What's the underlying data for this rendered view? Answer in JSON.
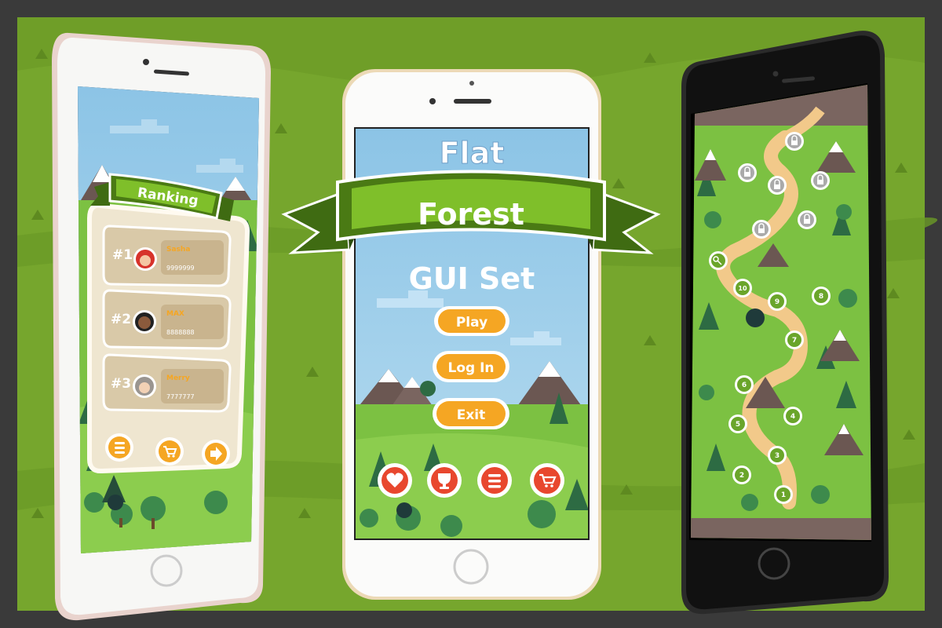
{
  "colors": {
    "frame": "#3a3a3a",
    "banner_green": "#4a7a14",
    "banner_light": "#7fbf2a",
    "button_orange": "#f5a623",
    "icon_red": "#e8472e",
    "sky": "#9bcbe8",
    "grass": "#7cc142",
    "panel_beige": "#d9c9a8",
    "path_sand": "#f2c98a"
  },
  "promo": {
    "title_top": "Flat",
    "title_banner": "Forest",
    "title_bottom": "GUI Set"
  },
  "ranking_screen": {
    "title": "Ranking",
    "entries": [
      {
        "rank": "#1",
        "name": "Sasha",
        "score": "9999999",
        "avatar": "avatar-red-hair"
      },
      {
        "rank": "#2",
        "name": "MAX",
        "score": "8888888",
        "avatar": "avatar-bearded-man"
      },
      {
        "rank": "#3",
        "name": "Merry",
        "score": "7777777",
        "avatar": "avatar-grey-hair"
      }
    ],
    "bottom_icons": [
      "list-icon",
      "cart-icon",
      "arrow-right-icon"
    ]
  },
  "menu_screen": {
    "buttons": [
      "Play",
      "Log In",
      "Exit"
    ],
    "bottom_icons": [
      "heart-icon",
      "trophy-icon",
      "list-icon",
      "cart-icon"
    ]
  },
  "map_screen": {
    "levels": [
      "1",
      "2",
      "3",
      "4",
      "5",
      "6",
      "7",
      "8",
      "9",
      "10"
    ],
    "special_icon": "key-icon",
    "locked_count": 7
  }
}
